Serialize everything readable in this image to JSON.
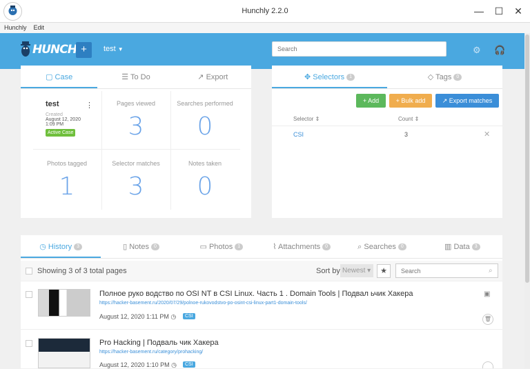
{
  "window": {
    "title": "Hunchly 2.2.0",
    "minimize": "—",
    "maximize": "☐",
    "close": "✕"
  },
  "menu": [
    "Hunchly",
    "Edit"
  ],
  "header": {
    "logo_text": "HUNCHLY",
    "add_label": "+",
    "case_name": "test",
    "search_placeholder": "Search"
  },
  "case_panel": {
    "tabs": [
      {
        "label": "Case",
        "icon": "briefcase-icon"
      },
      {
        "label": "To Do",
        "icon": "list-icon"
      },
      {
        "label": "Export",
        "icon": "export-icon"
      }
    ],
    "case_name": "test",
    "created_label": "Created",
    "created_date": "August 12, 2020",
    "created_time": "1:09 PM",
    "status": "Active Case",
    "stats": [
      {
        "label": "Pages viewed",
        "value": "3"
      },
      {
        "label": "Searches performed",
        "value": "0"
      },
      {
        "label": "Photos tagged",
        "value": "1"
      },
      {
        "label": "Selector matches",
        "value": "3"
      },
      {
        "label": "Notes taken",
        "value": "0"
      }
    ]
  },
  "selectors_panel": {
    "tabs": [
      {
        "label": "Selectors",
        "count": "1"
      },
      {
        "label": "Tags",
        "count": "0"
      }
    ],
    "add_label": "+ Add",
    "bulk_add_label": "+ Bulk add",
    "export_label": "Export matches",
    "col_selector": "Selector ⇕",
    "col_count": "Count ⇕",
    "rows": [
      {
        "selector": "CSI",
        "count": "3"
      }
    ]
  },
  "history_panel": {
    "tabs": [
      {
        "label": "History",
        "count": "3"
      },
      {
        "label": "Notes",
        "count": "0"
      },
      {
        "label": "Photos",
        "count": "1"
      },
      {
        "label": "Attachments",
        "count": "0"
      },
      {
        "label": "Searches",
        "count": "0"
      },
      {
        "label": "Data",
        "count": "3"
      }
    ],
    "showing": "Showing 3 of 3 total pages",
    "sort_label": "Sort by",
    "sort_value": "Newest ▾",
    "search_placeholder": "Search",
    "pages": [
      {
        "title": "Полное руко водство по OSI NT в CSI Linux. Часть 1 . Domain Tools | Подвал ьчик Хакера",
        "url": "https://hacker-basement.ru/2020/07/29/polnoe-rukovodstvo-po-osint-csi-linux-part1-domain-tools/",
        "date": "August 12, 2020 1:11 PM",
        "tag": "CSI"
      },
      {
        "title": "Pro Hacking | Подваль чик Хакера",
        "url": "https://hacker-basement.ru/category/prohacking/",
        "date": "August 12, 2020 1:10 PM",
        "tag": "CSI"
      }
    ]
  }
}
